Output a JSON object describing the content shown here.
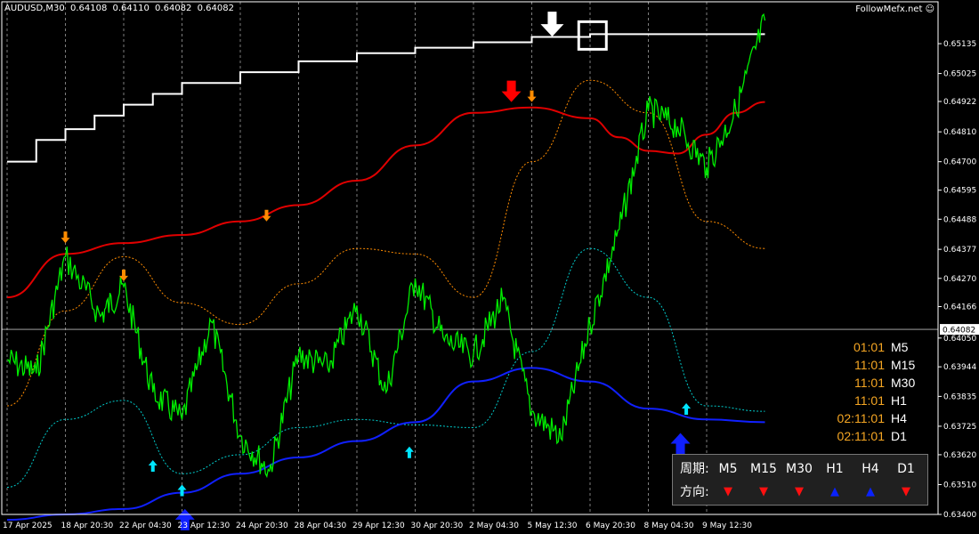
{
  "header": {
    "symbol": "AUDUSD,M30",
    "open": "0.64108",
    "high": "0.64110",
    "low": "0.64082",
    "close": "0.64082",
    "brand": "FollowMefx.net",
    "brand_icon": "smiley-icon"
  },
  "chart_data": {
    "type": "line",
    "title": "",
    "symbol": "AUDUSD",
    "timeframe": "M30",
    "ylim": [
      0.634,
      0.6525
    ],
    "y_ticks": [
      "0.65135",
      "0.65025",
      "0.64922",
      "0.64810",
      "0.64700",
      "0.64595",
      "0.64488",
      "0.64377",
      "0.64270",
      "0.64166",
      "0.64050",
      "0.63944",
      "0.63835",
      "0.63725",
      "0.63620",
      "0.63510",
      "0.63400"
    ],
    "x_ticks": [
      "17 Apr 2025",
      "18 Apr 20:30",
      "22 Apr 04:30",
      "23 Apr 12:30",
      "24 Apr 20:30",
      "28 Apr 04:30",
      "29 Apr 12:30",
      "30 Apr 20:30",
      "2 May 04:30",
      "5 May 12:30",
      "6 May 20:30",
      "8 May 04:30",
      "9 May 12:30"
    ],
    "current_price": "0.64082",
    "grid": "vertical dashed",
    "colors": {
      "price": "#00ee00",
      "upper_ma": "#e00000",
      "lower_ma": "#1020ff",
      "step": "#ffffff",
      "env_upper": "#ff8c00",
      "env_lower": "#00cccc",
      "down_arrow": "#ff8c00",
      "up_arrow": "#00e5ff",
      "big_down": "#ff0000",
      "big_up": "#1020ff",
      "axis_text": "#ffffff"
    },
    "series": [
      {
        "key": "price",
        "x": [
          0,
          0.5,
          1,
          1.6,
          2,
          2.5,
          3,
          3.5,
          4,
          4.5,
          5,
          5.5,
          6,
          6.5,
          7,
          7.5,
          8,
          8.5,
          9,
          9.5,
          10,
          10.5,
          11,
          11.5,
          12,
          12.5,
          13
        ],
        "values": [
          0.6397,
          0.6392,
          0.6435,
          0.6413,
          0.6424,
          0.6385,
          0.6375,
          0.6411,
          0.6369,
          0.6356,
          0.6399,
          0.6394,
          0.6417,
          0.6385,
          0.6427,
          0.6404,
          0.6399,
          0.6419,
          0.6378,
          0.6368,
          0.641,
          0.6445,
          0.6489,
          0.6483,
          0.6468,
          0.6489,
          0.6522
        ]
      },
      {
        "key": "upper_ma",
        "x": [
          0,
          1,
          2,
          3,
          4,
          5,
          6,
          7,
          8,
          9,
          10,
          10.5,
          11,
          11.5,
          12,
          12.5,
          13
        ],
        "values": [
          0.642,
          0.6436,
          0.644,
          0.6443,
          0.6448,
          0.6454,
          0.6463,
          0.6476,
          0.6488,
          0.649,
          0.6486,
          0.6479,
          0.6474,
          0.6473,
          0.648,
          0.6488,
          0.6492
        ]
      },
      {
        "key": "lower_ma",
        "x": [
          0,
          1,
          2,
          3,
          4,
          5,
          6,
          7,
          8,
          9,
          10,
          11,
          12,
          13
        ],
        "values": [
          0.6338,
          0.634,
          0.6342,
          0.6348,
          0.6355,
          0.6361,
          0.6367,
          0.6374,
          0.6389,
          0.6394,
          0.6389,
          0.6379,
          0.6375,
          0.6374
        ]
      },
      {
        "key": "step",
        "x": [
          0,
          0.5,
          1,
          1.5,
          2,
          2.5,
          3,
          4,
          5,
          6,
          7,
          8,
          9,
          10,
          11,
          12,
          13
        ],
        "values": [
          0.647,
          0.6478,
          0.6482,
          0.6487,
          0.6491,
          0.6495,
          0.6499,
          0.6503,
          0.6507,
          0.651,
          0.6512,
          0.6514,
          0.6516,
          0.6517,
          0.6517,
          0.6517,
          0.6517
        ]
      },
      {
        "key": "env_upper",
        "x": [
          0,
          1,
          2,
          3,
          4,
          5,
          6,
          7,
          8,
          9,
          10,
          11,
          12,
          13
        ],
        "values": [
          0.638,
          0.6415,
          0.6435,
          0.6418,
          0.641,
          0.6425,
          0.6438,
          0.6436,
          0.642,
          0.647,
          0.65,
          0.6488,
          0.6448,
          0.6438
        ]
      },
      {
        "key": "env_lower",
        "x": [
          0,
          1,
          2,
          3,
          4,
          5,
          6,
          7,
          8,
          9,
          10,
          11,
          12,
          13
        ],
        "values": [
          0.635,
          0.6375,
          0.6382,
          0.6355,
          0.6362,
          0.6372,
          0.6375,
          0.6373,
          0.6372,
          0.64,
          0.6438,
          0.642,
          0.638,
          0.6378
        ]
      }
    ],
    "signals": [
      {
        "type": "down",
        "x": 1.0,
        "y": 0.644
      },
      {
        "type": "down",
        "x": 2.0,
        "y": 0.6426
      },
      {
        "type": "down",
        "x": 4.45,
        "y": 0.6448
      },
      {
        "type": "down",
        "x": 9.0,
        "y": 0.6492
      },
      {
        "type": "big_down",
        "x": 8.65,
        "y": 0.6492
      },
      {
        "type": "up",
        "x": 2.5,
        "y": 0.636
      },
      {
        "type": "up",
        "x": 3.0,
        "y": 0.6351
      },
      {
        "type": "big_up",
        "x": 3.05,
        "y": 0.6342
      },
      {
        "type": "up",
        "x": 6.9,
        "y": 0.6365
      },
      {
        "type": "up",
        "x": 11.65,
        "y": 0.6381
      },
      {
        "type": "big_up",
        "x": 11.55,
        "y": 0.637
      }
    ],
    "box_marker": {
      "x": 10.05,
      "y": 0.6517
    },
    "top_arrow": {
      "x": 9.35,
      "y": 0.6522
    }
  },
  "timers": [
    {
      "time": "01:01",
      "period": "M5"
    },
    {
      "time": "11:01",
      "period": "M15"
    },
    {
      "time": "11:01",
      "period": "M30"
    },
    {
      "time": "11:01",
      "period": "H1"
    },
    {
      "time": "02:11:01",
      "period": "H4"
    },
    {
      "time": "02:11:01",
      "period": "D1"
    }
  ],
  "panel": {
    "period_label": "周期:",
    "direction_label": "方向:",
    "periods": [
      "M5",
      "M15",
      "M30",
      "H1",
      "H4",
      "D1"
    ],
    "directions": [
      "down",
      "down",
      "down",
      "up",
      "up",
      "down"
    ],
    "down_glyph": "▼",
    "up_glyph": "▲"
  }
}
